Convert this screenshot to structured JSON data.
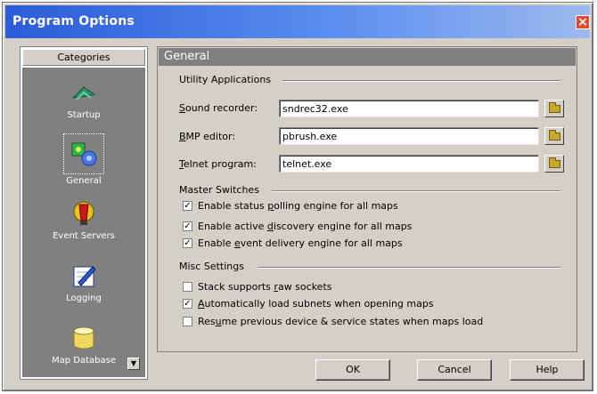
{
  "window": {
    "title": "Program Options",
    "close_glyph": "×"
  },
  "sidebar": {
    "header": "Categories",
    "items": [
      {
        "label": "Startup",
        "icon": "startup-icon"
      },
      {
        "label": "General",
        "icon": "general-icon",
        "selected": true
      },
      {
        "label": "Event Servers",
        "icon": "event-servers-icon"
      },
      {
        "label": "Logging",
        "icon": "logging-icon"
      },
      {
        "label": "Map Database",
        "icon": "map-database-icon"
      }
    ],
    "scroll_glyph": "▼"
  },
  "panel": {
    "title": "General",
    "utility": {
      "heading": "Utility Applications",
      "fields": [
        {
          "label_pre": "",
          "label_u": "S",
          "label_post": "ound recorder:",
          "value": "sndrec32.exe"
        },
        {
          "label_pre": "",
          "label_u": "B",
          "label_post": "MP editor:",
          "value": "pbrush.exe"
        },
        {
          "label_pre": "",
          "label_u": "T",
          "label_post": "elnet program:",
          "value": "telnet.exe"
        }
      ]
    },
    "master": {
      "heading": "Master Switches",
      "items": [
        {
          "pre": "Enable status ",
          "u": "p",
          "post": "olling engine for all maps",
          "checked": true
        },
        {
          "pre": "Enable active ",
          "u": "d",
          "post": "iscovery engine for all maps",
          "checked": true
        },
        {
          "pre": "Enable ",
          "u": "e",
          "post": "vent delivery engine for all maps",
          "checked": true
        }
      ]
    },
    "misc": {
      "heading": "Misc Settings",
      "items": [
        {
          "pre": "Stack supports ",
          "u": "r",
          "post": "aw sockets",
          "checked": false
        },
        {
          "pre": "",
          "u": "A",
          "post": "utomatically load subnets when opening maps",
          "checked": true
        },
        {
          "pre": "Res",
          "u": "u",
          "post": "me previous device & service states when maps load",
          "checked": false
        }
      ]
    }
  },
  "buttons": {
    "ok": "OK",
    "cancel": "Cancel",
    "help": "Help"
  },
  "check_glyph": "✓"
}
